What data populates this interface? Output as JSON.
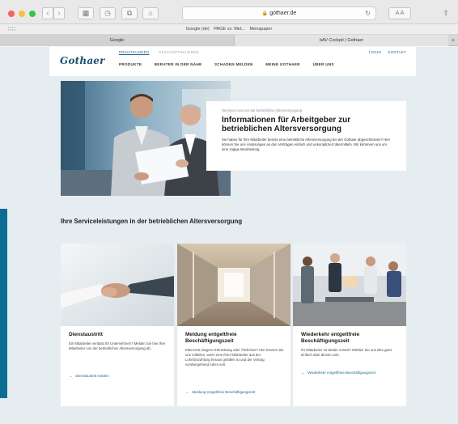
{
  "browser": {
    "url": "gothaer.de",
    "bookmarks": [
      "Google (de)",
      "PAGE vs. Met...",
      "Menapaper"
    ],
    "tabs": [
      "Google",
      "bAV Cockpit | Gothaer"
    ],
    "font_button": "A A"
  },
  "site": {
    "logo": "Gothaer",
    "top_nav": [
      "PRIVATKUNDEN",
      "GESCHÄFTSKUNDEN"
    ],
    "util_nav": [
      "LOGIN",
      "KONTAKT"
    ],
    "main_nav": [
      "PRODUKTE",
      "BERATER IN DER NÄHE",
      "SCHADEN MELDEN",
      "MEINE GOTHAER",
      "ÜBER UNS"
    ]
  },
  "hero": {
    "kicker": "Services rund um die betriebliche Altersversorgung",
    "title": "Informationen für Arbeitgeber zur betrieblichen Altersversorgung",
    "text": "Sie haben für Ihre Mitarbeiter bereits eine betriebliche Altersversorgung bei der Gothaer abgeschlossen? Hier können Sie uns Änderungen an den Verträgen einfach und unkompliziert übermitteln. Wir kümmern uns um eine zügige Bearbeitung."
  },
  "section": {
    "title": "Ihre Serviceleistungen in der betrieblichen Altersversorgung"
  },
  "cards": [
    {
      "title": "Dienstaustritt",
      "text": "Ein Mitarbeiter verlässt Ihr Unternehmen? Melden Sie hier Ihre Mitarbeiter von der betrieblichen Altersversorgung ab.",
      "link": "Dienstaustritt melden"
    },
    {
      "title": "Meldung entgeltfreie Beschäftigungszeit",
      "text": "Elternzeit, längere Erkrankung oder Ähnliches? Hier können Sie uns mitteilen, wenn eine Ihrer Mitarbeiter aus der Lohnfortzahlung heraus gefallen ist und der Vertrag vorübergehend ruhen soll.",
      "link": "Meldung entgeltfreie Beschäftigungszeit"
    },
    {
      "title": "Wiederkehr entgeltfreie Beschäftigungszeit",
      "text": "Ihr Mitarbeiter ist wieder zurück? Melden Sie uns dies ganz einfach über diesen Link.",
      "link": "Wiederkehr entgeltfreie Beschäftigungszeit"
    }
  ],
  "colors": {
    "brand_blue": "#1b4f6e",
    "link_blue": "#1b6a8f",
    "page_bg": "#e6edf1",
    "accent_bar": "#0c6d93"
  }
}
